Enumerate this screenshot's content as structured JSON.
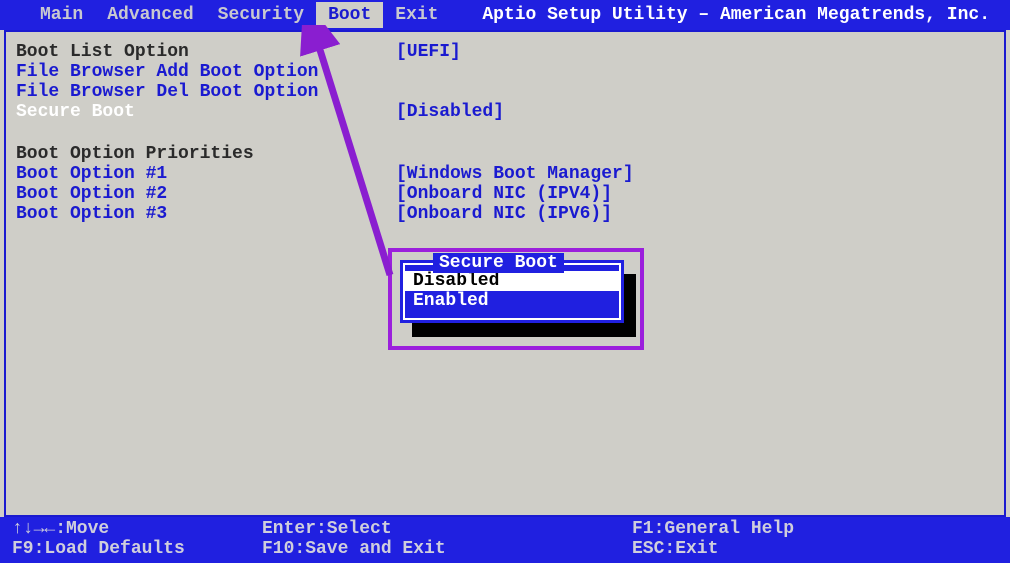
{
  "header": {
    "title": "Aptio Setup Utility – American Megatrends, Inc.",
    "tabs": [
      "Main",
      "Advanced",
      "Security",
      "Boot",
      "Exit"
    ],
    "active_tab": "Boot"
  },
  "settings": {
    "boot_list_option": {
      "label": "Boot List Option",
      "value": "[UEFI]"
    },
    "file_browser_add": {
      "label": "File Browser Add Boot Option"
    },
    "file_browser_del": {
      "label": "File Browser Del Boot Option"
    },
    "secure_boot": {
      "label": "Secure Boot",
      "value": "[Disabled]"
    },
    "priorities_header": "Boot Option Priorities",
    "options": [
      {
        "label": "Boot Option #1",
        "value": "[Windows Boot Manager]"
      },
      {
        "label": "Boot Option #2",
        "value": "[Onboard NIC (IPV4)]"
      },
      {
        "label": "Boot Option #3",
        "value": "[Onboard NIC (IPV6)]"
      }
    ]
  },
  "popup": {
    "title": "Secure Boot",
    "options": [
      "Disabled",
      "Enabled"
    ],
    "selected": "Disabled"
  },
  "footer": {
    "move": "↑↓→←:Move",
    "defaults": "F9:Load Defaults",
    "select": "Enter:Select",
    "save": "F10:Save and Exit",
    "help": "F1:General Help",
    "exit": "ESC:Exit"
  }
}
